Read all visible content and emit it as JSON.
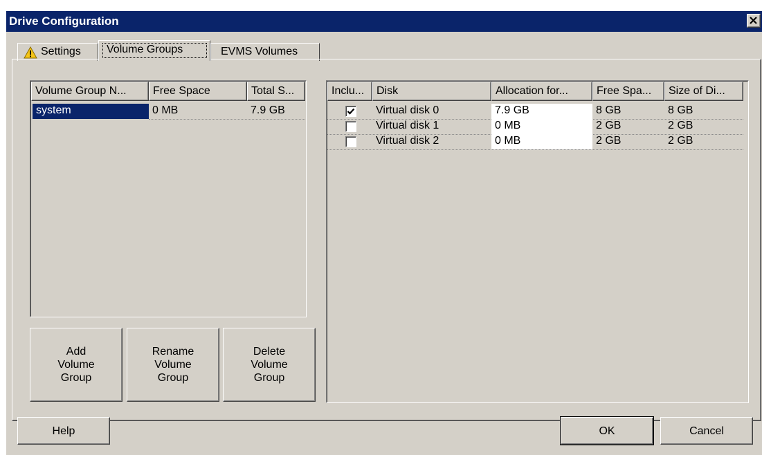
{
  "window": {
    "title": "Drive Configuration",
    "close_glyph": "✕"
  },
  "tabs": [
    {
      "label": "Settings",
      "icon": "warning-icon",
      "active": false
    },
    {
      "label": "Volume Groups",
      "active": true
    },
    {
      "label": "EVMS Volumes",
      "active": false
    }
  ],
  "volume_groups": {
    "columns": [
      "Volume Group N...",
      "Free Space",
      "Total S..."
    ],
    "rows": [
      {
        "name": "system",
        "free_space": "0 MB",
        "total_size": "7.9 GB",
        "selected": true
      }
    ]
  },
  "vg_buttons": {
    "add": "Add\nVolume\nGroup",
    "rename": "Rename\nVolume\nGroup",
    "delete": "Delete\nVolume\nGroup"
  },
  "disks": {
    "columns": [
      "Inclu...",
      "Disk",
      "Allocation for...",
      "Free Spa...",
      "Size of Di..."
    ],
    "rows": [
      {
        "included": true,
        "disk": "Virtual disk 0",
        "allocation": "7.9 GB",
        "free_space": "8 GB",
        "size": "8 GB"
      },
      {
        "included": false,
        "disk": "Virtual disk 1",
        "allocation": "0 MB",
        "free_space": "2 GB",
        "size": "2 GB"
      },
      {
        "included": false,
        "disk": "Virtual disk 2",
        "allocation": "0 MB",
        "free_space": "2 GB",
        "size": "2 GB"
      }
    ]
  },
  "footer": {
    "help": "Help",
    "ok": "OK",
    "cancel": "Cancel"
  },
  "colors": {
    "titlebar": "#0a246a",
    "face": "#d4d0c8",
    "selection": "#0a246a"
  }
}
